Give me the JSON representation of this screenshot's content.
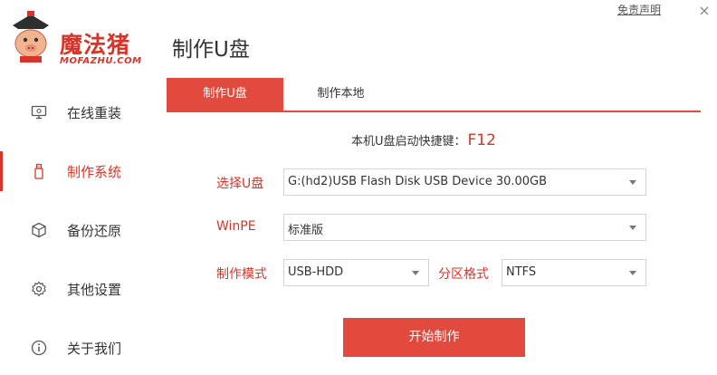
{
  "app": {
    "logo_text": "魔法猪",
    "logo_sub": "MOFAZHU.COM",
    "page_title": "制作U盘",
    "disclaimer": "免责声明",
    "close": "×"
  },
  "sidebar": {
    "items": [
      {
        "label": "在线重装",
        "icon": "monitor-icon"
      },
      {
        "label": "制作系统",
        "icon": "usb-drive-icon",
        "active": true
      },
      {
        "label": "备份还原",
        "icon": "backup-cube-icon"
      },
      {
        "label": "其他设置",
        "icon": "gear-icon"
      },
      {
        "label": "关于我们",
        "icon": "info-icon"
      }
    ]
  },
  "tabs": [
    {
      "label": "制作U盘",
      "active": true
    },
    {
      "label": "制作本地",
      "active": false
    }
  ],
  "hotkey": {
    "label": "本机U盘启动快捷键：",
    "key": "F12"
  },
  "form": {
    "usb_label": "选择U盘",
    "usb_value": "G:(hd2)USB Flash Disk USB Device 30.00GB",
    "winpe_label": "WinPE",
    "winpe_value": "标准版",
    "mode_label": "制作模式",
    "mode_value": "USB-HDD",
    "partition_label": "分区格式",
    "partition_value": "NTFS"
  },
  "start_button": "开始制作",
  "colors": {
    "accent": "#e14a3c",
    "brand": "#d8352a"
  }
}
